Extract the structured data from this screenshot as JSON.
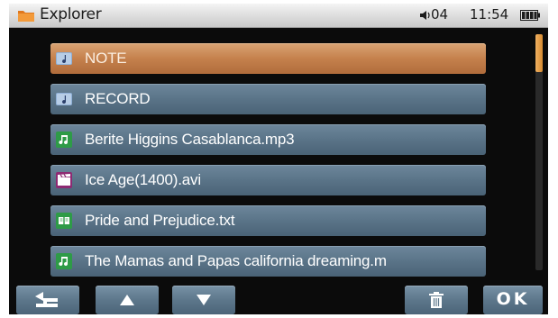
{
  "status_bar": {
    "title": "Explorer",
    "volume": "04",
    "time": "11:54",
    "icons": [
      "folder-icon",
      "volume-icon",
      "battery-icon"
    ]
  },
  "files": [
    {
      "name": "NOTE",
      "icon": "folder-music-icon",
      "selected": true
    },
    {
      "name": "RECORD",
      "icon": "folder-music-icon",
      "selected": false
    },
    {
      "name": "Berite Higgins Casablanca.mp3",
      "icon": "music-note-icon",
      "selected": false
    },
    {
      "name": "Ice Age(1400).avi",
      "icon": "clapperboard-icon",
      "selected": false
    },
    {
      "name": "Pride and Prejudice.txt",
      "icon": "book-icon",
      "selected": false
    },
    {
      "name": "The Mamas and Papas california dreaming.m",
      "icon": "music-note-icon",
      "selected": false
    }
  ],
  "toolbar": {
    "back_icon": "back-arrow-icon",
    "up_icon": "up-arrow-icon",
    "down_icon": "down-arrow-icon",
    "delete_icon": "trash-icon",
    "ok_label": "OK"
  },
  "colors": {
    "item_bg": "#5a7488",
    "selected_bg": "#c5814d",
    "screen_bg": "#0b0b0b",
    "scroll_thumb": "#e09a40"
  }
}
